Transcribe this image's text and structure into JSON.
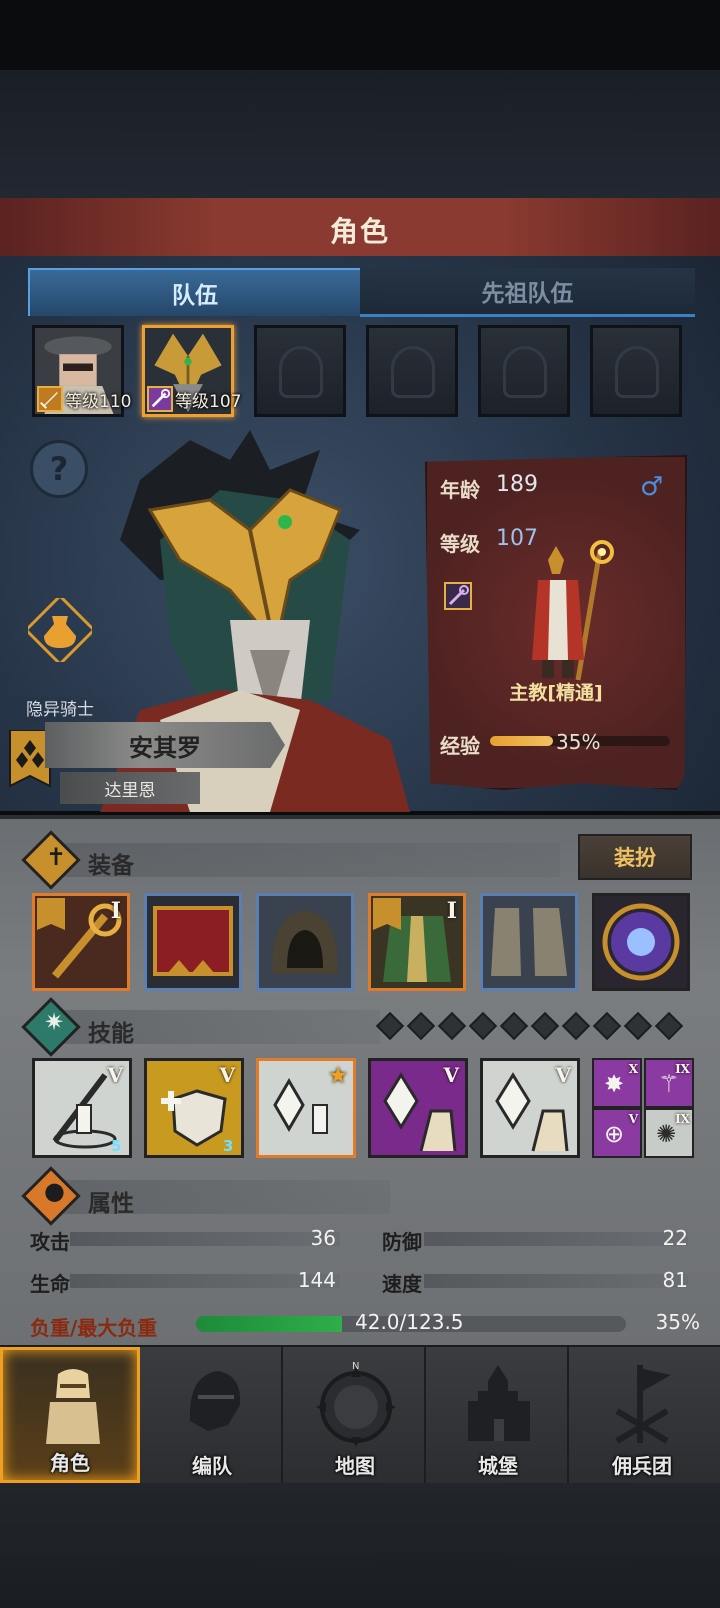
{
  "header": {
    "title": "角色"
  },
  "tabs": [
    {
      "label": "队伍"
    },
    {
      "label": "先祖队伍"
    }
  ],
  "team": [
    {
      "level_text": "等级110",
      "class": "sword"
    },
    {
      "level_text": "等级107",
      "class": "staff",
      "selected": true
    }
  ],
  "hero": {
    "subclass": "隐异骑士",
    "name": "安其罗",
    "surname": "达里恩"
  },
  "info": {
    "age_label": "年龄",
    "age": "189",
    "level_label": "等级",
    "level": "107",
    "gender_icon": "male-icon",
    "class_name": "主教[精通]",
    "exp_label": "经验",
    "exp_percent": 35,
    "exp_text": "35%"
  },
  "equipment": {
    "title": "装备",
    "dress_label": "装扮",
    "items": [
      {
        "name": "staff",
        "rarity": "orange",
        "tier": "I"
      },
      {
        "name": "chest-box",
        "rarity": "blue",
        "tier": ""
      },
      {
        "name": "hood",
        "rarity": "blue",
        "tier": ""
      },
      {
        "name": "armor",
        "rarity": "orange",
        "tier": "I"
      },
      {
        "name": "boots",
        "rarity": "blue",
        "tier": ""
      },
      {
        "name": "astrolabe",
        "rarity": "dark",
        "tier": ""
      }
    ]
  },
  "skills": {
    "title": "技能",
    "items": [
      {
        "tier": "V",
        "badge": "5"
      },
      {
        "tier": "V",
        "badge": "3"
      },
      {
        "tier": "★",
        "badge": ""
      },
      {
        "tier": "V",
        "badge": ""
      },
      {
        "tier": "V",
        "badge": ""
      }
    ],
    "mini": [
      {
        "tier": "X"
      },
      {
        "tier": "IX"
      },
      {
        "tier": "V"
      },
      {
        "tier": "IX"
      }
    ]
  },
  "attributes": {
    "title": "属性",
    "attack_label": "攻击",
    "attack": "36",
    "defense_label": "防御",
    "defense": "22",
    "hp_label": "生命",
    "hp": "144",
    "speed_label": "速度",
    "speed": "81",
    "load_label": "负重/最大负重",
    "load_value": "42.0/123.5",
    "load_percent_text": "35%",
    "load_fraction": 0.34
  },
  "nav": [
    {
      "label": "角色"
    },
    {
      "label": "编队"
    },
    {
      "label": "地图"
    },
    {
      "label": "城堡"
    },
    {
      "label": "佣兵团"
    }
  ],
  "colors": {
    "accent_orange": "#f0a020",
    "tab_blue": "#3b7fc4",
    "exp_gold": "#e8a030",
    "load_green": "#2fae4a"
  }
}
